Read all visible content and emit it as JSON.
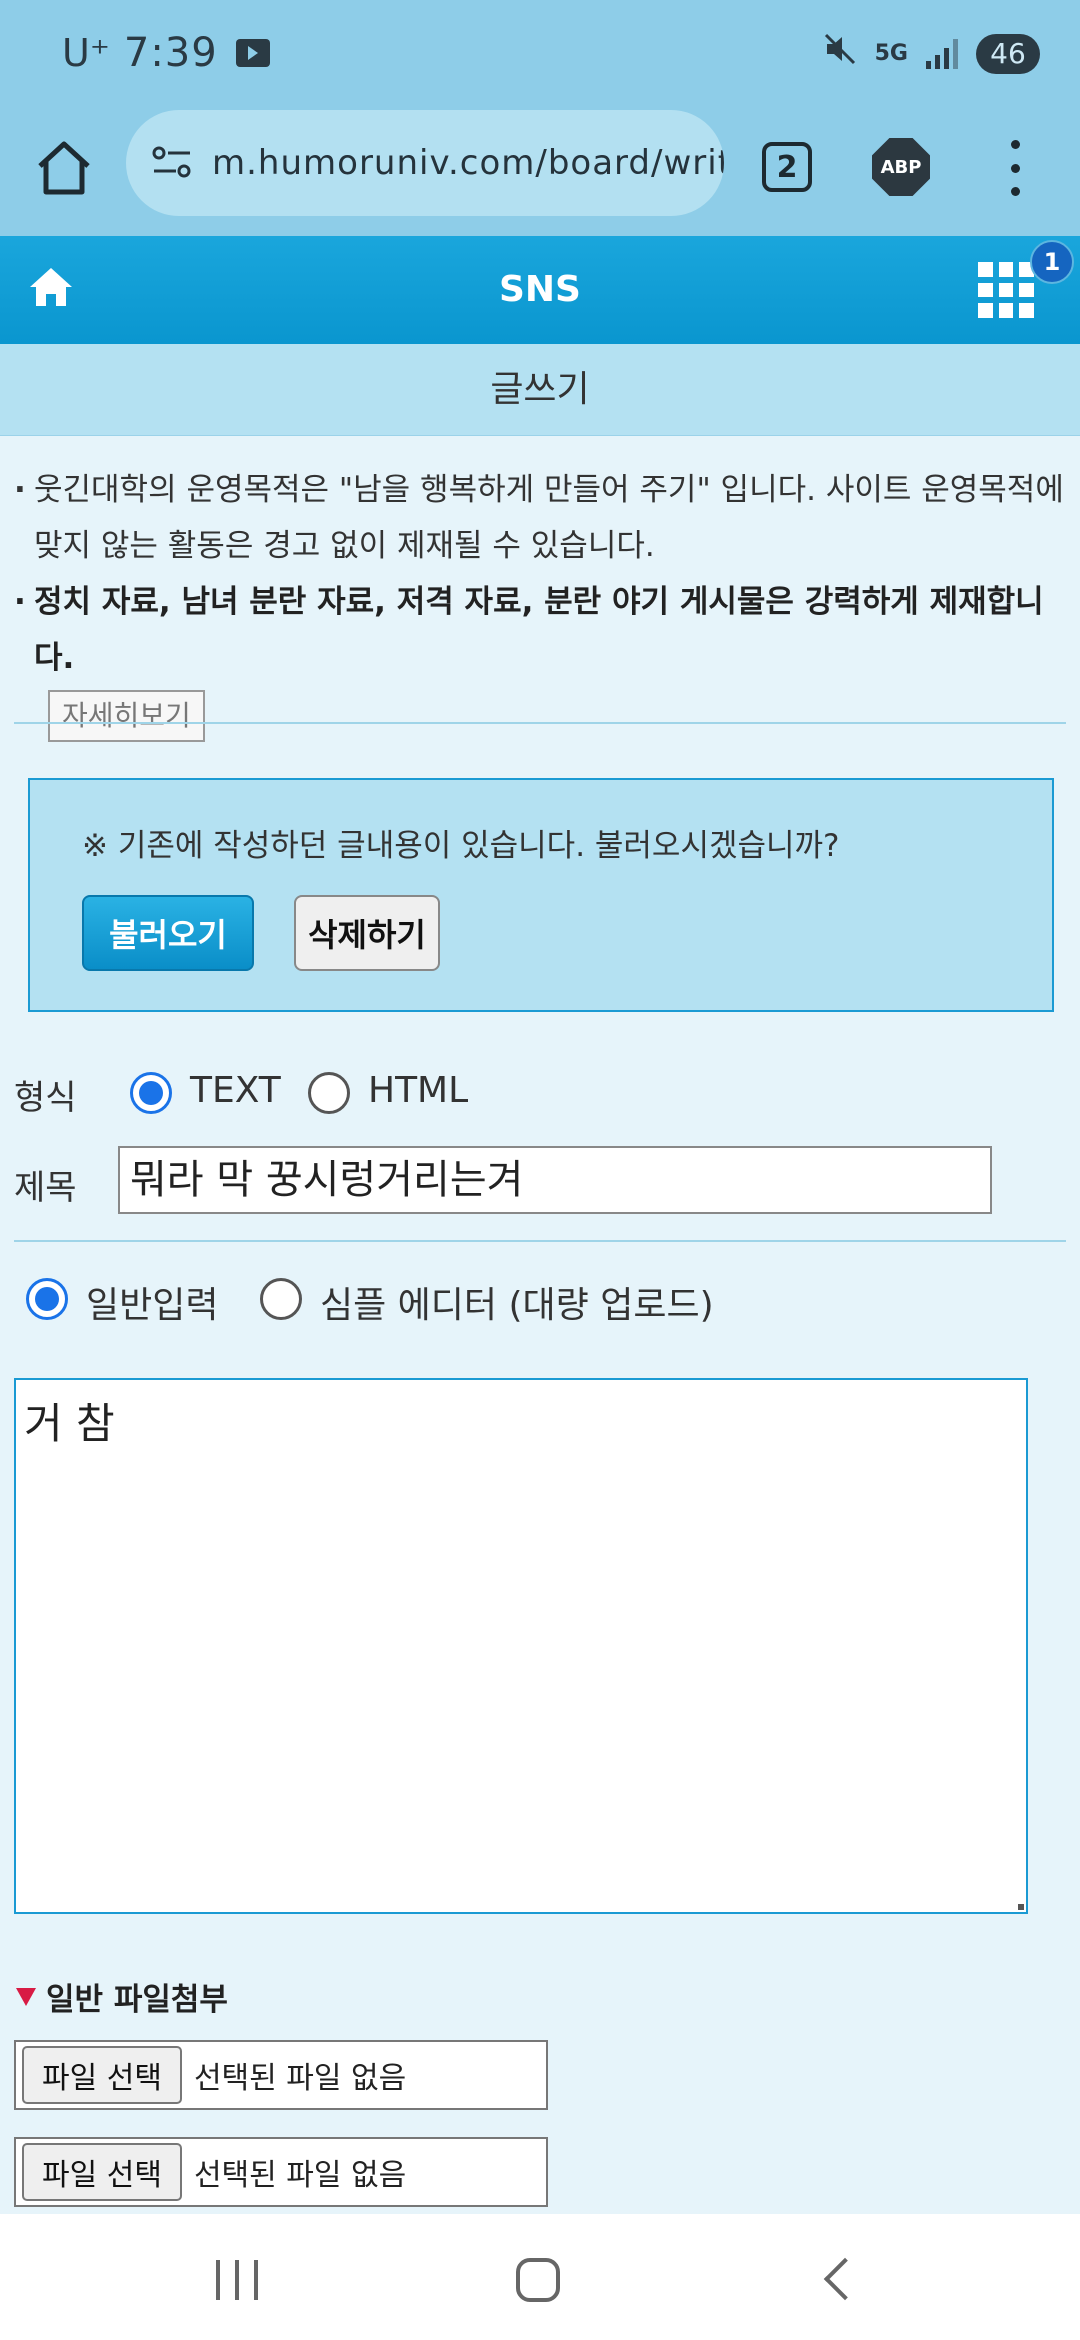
{
  "status_bar": {
    "carrier": "U⁺",
    "time": "7:39",
    "network": "5G",
    "battery": "46"
  },
  "browser": {
    "url": "m.humoruniv.com/board/writ",
    "tab_count": "2",
    "adblock_label": "ABP"
  },
  "site": {
    "title": "SNS",
    "notification_count": "1",
    "page_title": "글쓰기"
  },
  "notices": {
    "line1": "웃긴대학의 운영목적은 \"남을 행복하게 만들어 주기\" 입니다. 사이트 운영목적에 맞지 않는 활동은 경고 없이 제재될 수 있습니다.",
    "line2": "정치 자료, 남녀 분란 자료, 저격 자료, 분란 야기 게시물은 강력하게 제재합니다.",
    "detail_button": "자세히보기"
  },
  "draft": {
    "message": "※ 기존에 작성하던 글내용이 있습니다. 불러오시겠습니까?",
    "load_button": "불러오기",
    "delete_button": "삭제하기"
  },
  "form": {
    "format_label": "형식",
    "format_options": [
      "TEXT",
      "HTML"
    ],
    "format_selected": "TEXT",
    "subject_label": "제목",
    "subject_value": "뭐라 막 꿍시렁거리는겨",
    "input_modes": [
      "일반입력",
      "심플 에디터 (대량 업로드)"
    ],
    "input_mode_selected": "일반입력",
    "body_value": "거 참"
  },
  "attachments": {
    "title": "일반 파일첨부",
    "files": [
      {
        "button": "파일 선택",
        "status": "선택된 파일 없음"
      },
      {
        "button": "파일 선택",
        "status": "선택된 파일 없음"
      }
    ]
  },
  "colors": {
    "header_blue": "#0a96cf",
    "light_blue": "#b4e1f2",
    "page_bg": "#e6f4fa",
    "radio_checked": "#1a73e8",
    "attach_marker": "#d81b44"
  }
}
